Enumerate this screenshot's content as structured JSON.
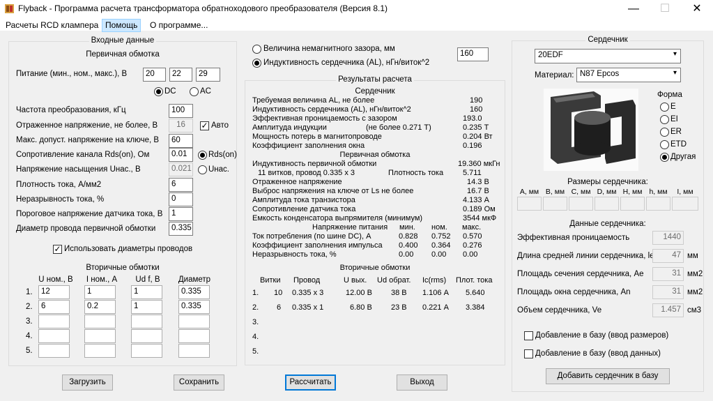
{
  "window": {
    "title": "Flyback - Программа расчета трансформатора обратноходового преобразователя (Версия 8.1)",
    "minimize": "—",
    "maximize": "☐",
    "close": "✕"
  },
  "menu": [
    "Расчеты RCD клампера",
    "Помощь",
    "О программе..."
  ],
  "input": {
    "group_title": "Входные данные",
    "primary_title": "Первичная обмотка",
    "supply_label": "Питание (мин., ном., макс.), В",
    "supply_values": [
      "20",
      "22",
      "29"
    ],
    "dc_label": "DC",
    "ac_label": "AC",
    "freq_label": "Частота преобразования, кГц",
    "freq_value": "100",
    "refl_label": "Отраженное напряжение, не более, В",
    "refl_value": "16",
    "auto_label": "Авто",
    "maxv_label": "Макс. допуст. напряжение на ключе, В",
    "maxv_value": "60",
    "rds_label": "Сопротивление канала Rds(on), Ом",
    "rds_value": "0.01",
    "rds_radio": "Rds(on)",
    "usat_label": "Напряжение насыщения Uнас., В",
    "usat_value": "0.021",
    "usat_radio": "Uнас.",
    "jd_label": "Плотность тока, А/мм2",
    "jd_value": "6",
    "cont_label": "Неразрывность тока, %",
    "cont_value": "0",
    "thr_label": "Пороговое напряжение датчика тока, В",
    "thr_value": "1",
    "wire_label": "Диаметр провода первичной обмотки",
    "wire_value": "0.335",
    "use_diam_label": "Использовать диаметры проводов",
    "sec_title": "Вторичные обмотки",
    "sec_headers": [
      "U ном., В",
      "I ном., А",
      "Ud f, В",
      "Диаметр"
    ],
    "sec_rows": [
      {
        "n": "1.",
        "u": "12",
        "i": "1",
        "ud": "1",
        "d": "0.335"
      },
      {
        "n": "2.",
        "u": "6",
        "i": "0.2",
        "ud": "1",
        "d": "0.335"
      },
      {
        "n": "3.",
        "u": "",
        "i": "",
        "ud": "",
        "d": ""
      },
      {
        "n": "4.",
        "u": "",
        "i": "",
        "ud": "",
        "d": ""
      },
      {
        "n": "5.",
        "u": "",
        "i": "",
        "ud": "",
        "d": ""
      }
    ]
  },
  "gap": {
    "gap_label": "Величина немагнитного зазора, мм",
    "al_label": "Индуктивность сердечника (AL), нГн/виток^2",
    "value": "160"
  },
  "results": {
    "title": "Результаты расчета",
    "core_title": "Сердечник",
    "core_rows": [
      {
        "label": "Требуемая величина AL, не более",
        "value": "190"
      },
      {
        "label": "Индуктивность сердечника (AL), нГн/виток^2",
        "value": "160"
      },
      {
        "label": "Эффективная проницаемость с зазором",
        "value": "193.0"
      },
      {
        "label": "Амплитуда индукции",
        "note": "(не более 0.271 Т)",
        "value": "0.235 Т"
      },
      {
        "label": "Мощность потерь в магнитопроводе",
        "value": "0.204 Вт"
      },
      {
        "label": "Коэффициент заполнения окна",
        "value": "0.196"
      }
    ],
    "prim_title": "Первичная обмотка",
    "prim_inductance_label": "Индуктивность первичной обмотки",
    "prim_inductance_value": "19.360 мкГн",
    "turns_label": "11 витков, провод 0.335 х 3",
    "density_label": "Плотность тока",
    "density_value": "5.711",
    "prim_rows": [
      {
        "label": "Отраженное напряжение",
        "value": "14.3 В"
      },
      {
        "label": "Выброс напряжения на ключе от Ls не более",
        "value": "16.7 В"
      },
      {
        "label": "Амплитуда тока транзистора",
        "value": "4.133 А"
      },
      {
        "label": "Сопротивление датчика тока",
        "value": "0.189 Ом"
      },
      {
        "label": "Емкость конденсатора выпрямителя (минимум)",
        "value": "3544 мкФ"
      }
    ],
    "supply_header": [
      "Напряжение питания",
      "мин.",
      "ном.",
      "макс."
    ],
    "supply_rows": [
      {
        "label": "Ток потребления (по шине DC), А",
        "v": [
          "0.828",
          "0.752",
          "0.570"
        ]
      },
      {
        "label": "Коэффициент заполнения импульса",
        "v": [
          "0.400",
          "0.364",
          "0.276"
        ]
      },
      {
        "label": "Неразрывность тока, %",
        "v": [
          "0.00",
          "0.00",
          "0.00"
        ]
      }
    ],
    "sec_title": "Вторичные обмотки",
    "sec_headers": [
      "Витки",
      "Провод",
      "U вых.",
      "Ud обрат.",
      "Ic(rms)",
      "Плот. тока"
    ],
    "sec_rows": [
      {
        "n": "1.",
        "turns": "10",
        "wire": "0.335 х 3",
        "u": "12.00 В",
        "ud": "38 В",
        "ic": "1.106 А",
        "j": "5.640"
      },
      {
        "n": "2.",
        "turns": "6",
        "wire": "0.335 х 1",
        "u": "6.80 В",
        "ud": "23 В",
        "ic": "0.221 А",
        "j": "3.384"
      },
      {
        "n": "3.",
        "turns": "",
        "wire": "",
        "u": "",
        "ud": "",
        "ic": "",
        "j": ""
      },
      {
        "n": "4.",
        "turns": "",
        "wire": "",
        "u": "",
        "ud": "",
        "ic": "",
        "j": ""
      },
      {
        "n": "5.",
        "turns": "",
        "wire": "",
        "u": "",
        "ud": "",
        "ic": "",
        "j": ""
      }
    ]
  },
  "core": {
    "title": "Сердечник",
    "selected_core": "20EDF",
    "material_label": "Материал:",
    "material_value": "N87 Epcos",
    "form_label": "Форма",
    "forms": [
      "E",
      "EI",
      "ER",
      "ETD",
      "Другая"
    ],
    "sizes_title": "Размеры сердечника:",
    "size_headers": [
      "A, мм",
      "B, мм",
      "C, мм",
      "D, мм",
      "H, мм",
      "h, мм",
      "I, мм"
    ],
    "data_title": "Данные сердечника:",
    "data_rows": [
      {
        "label": "Эффективная проницаемость",
        "value": "1440",
        "unit": ""
      },
      {
        "label": "Длина средней линии сердечника, le",
        "value": "47",
        "unit": "мм"
      },
      {
        "label": "Площадь сечения сердечника, Ae",
        "value": "31",
        "unit": "мм2"
      },
      {
        "label": "Площадь окна сердечника, An",
        "value": "31",
        "unit": "мм2"
      },
      {
        "label": "Объем сердечника, Ve",
        "value": "1.457",
        "unit": "см3"
      }
    ],
    "add_sizes_label": "Добавление в базу (ввод размеров)",
    "add_data_label": "Добавление в базу (ввод данных)",
    "add_core_button": "Добавить сердечник в базу"
  },
  "buttons": {
    "load": "Загрузить",
    "save": "Сохранить",
    "calc": "Рассчитать",
    "exit": "Выход"
  }
}
